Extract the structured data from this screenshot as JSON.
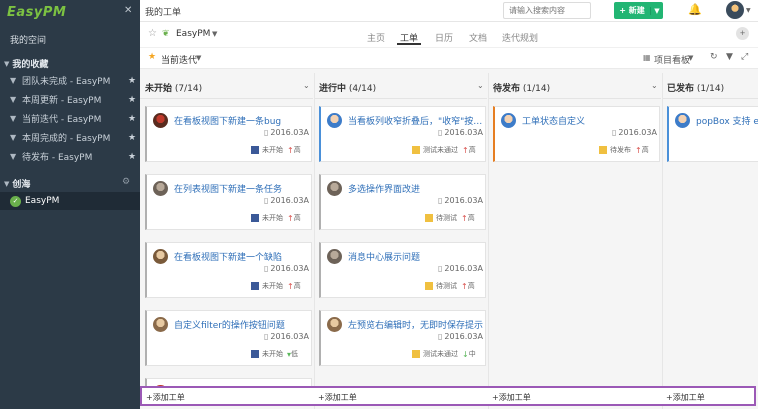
{
  "sidebar": {
    "logo": "EasyPM",
    "my_space": "我的空间",
    "favorites_title": "我的收藏",
    "favorites": [
      {
        "label": "团队未完成 - EasyPM"
      },
      {
        "label": "本周更新 - EasyPM"
      },
      {
        "label": "当前迭代 - EasyPM"
      },
      {
        "label": "本周完成的 - EasyPM"
      },
      {
        "label": "待发布 - EasyPM"
      }
    ],
    "team_title": "创海",
    "project": "EasyPM"
  },
  "topbar": {
    "title": "我的工单",
    "search_placeholder": "请输入搜索内容",
    "new_label": "+ 新建"
  },
  "project_bar": {
    "name": "EasyPM",
    "tabs": [
      {
        "label": "主页"
      },
      {
        "label": "工单"
      },
      {
        "label": "日历"
      },
      {
        "label": "文档"
      },
      {
        "label": "迭代规划"
      }
    ]
  },
  "filter_bar": {
    "current": "当前迭代",
    "board_label": "项目看板"
  },
  "colors": {
    "accent_green": "#22b573",
    "sidebar_bg": "#2c3a47",
    "status_todo": "#3b5998",
    "status_test": "#f0c040",
    "highlight": "#9b59b6"
  },
  "columns": [
    {
      "title": "未开始",
      "count": "(7/14)",
      "cards": [
        {
          "title": "在看板视图下新建一条bug",
          "date": "2016.03A",
          "status": "未开始",
          "priority": "高"
        },
        {
          "title": "在列表视图下新建一条任务",
          "date": "2016.03A",
          "status": "未开始",
          "priority": "高"
        },
        {
          "title": "在看板视图下新建一个缺陷",
          "date": "2016.03A",
          "status": "未开始",
          "priority": "高"
        },
        {
          "title": "自定义filter的操作按钮问题",
          "date": "2016.03A",
          "status": "未开始",
          "priority": "低"
        }
      ],
      "add": "+添加工单"
    },
    {
      "title": "进行中",
      "count": "(4/14)",
      "cards": [
        {
          "title": "当看板列收窄折叠后，\"收窄\"按…",
          "date": "2016.03A",
          "status": "测试未通过",
          "priority": "高"
        },
        {
          "title": "多选操作界面改进",
          "date": "2016.03A",
          "status": "待测试",
          "priority": "高"
        },
        {
          "title": "消息中心展示问题",
          "date": "2016.03A",
          "status": "待测试",
          "priority": "高"
        },
        {
          "title": "左预览右编辑时，无即时保存提示",
          "date": "2016.03A",
          "status": "测试未通过",
          "priority": "中"
        }
      ],
      "add": "+添加工单"
    },
    {
      "title": "待发布",
      "count": "(1/14)",
      "cards": [
        {
          "title": "工单状态自定义",
          "date": "2016.03A",
          "status": "待发布",
          "priority": "高"
        }
      ],
      "add": "+添加工单"
    },
    {
      "title": "已发布",
      "count": "(1/14)",
      "cards": [
        {
          "title": "popBox 支持 esc",
          "date": "",
          "status": "",
          "priority": ""
        }
      ],
      "add": "+添加工单"
    }
  ]
}
